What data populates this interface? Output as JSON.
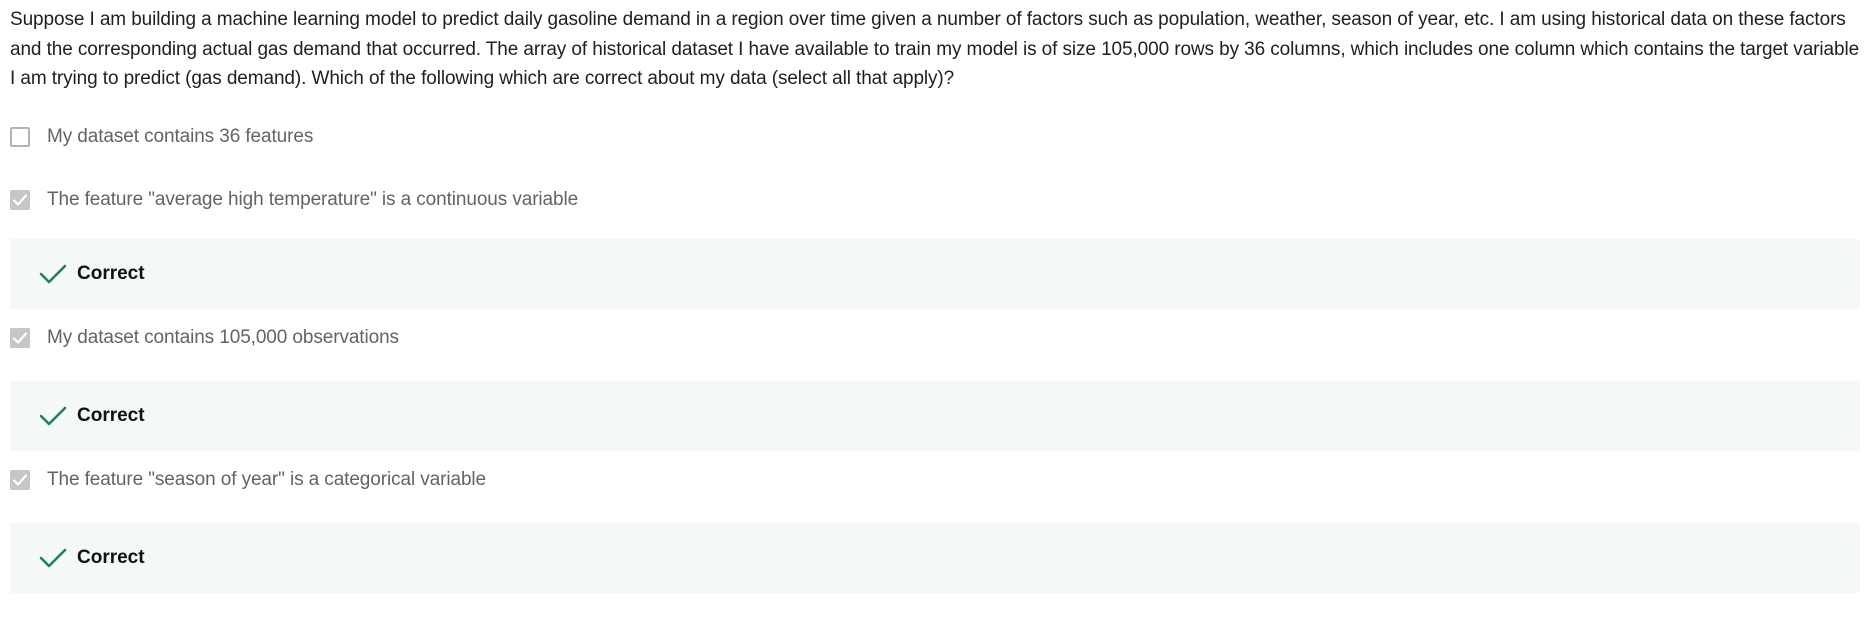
{
  "question": {
    "text": "Suppose I am building a machine learning model to predict daily gasoline demand in a region over time given a number of factors such as population, weather, season of year, etc.  I am using historical data on these factors and the corresponding actual gas demand that occurred.  The array of historical dataset I have available to train my model is of size 105,000 rows by 36 columns, which includes one column which contains the target variable I am trying to predict (gas demand). Which of the following which are correct about my data (select all that apply)?"
  },
  "options": [
    {
      "label": "My dataset contains 36 features",
      "checked": false
    },
    {
      "label": "The feature \"average high temperature\" is a continuous variable",
      "checked": true,
      "feedback": "Correct"
    },
    {
      "label": "My dataset contains 105,000 observations",
      "checked": true,
      "feedback": "Correct"
    },
    {
      "label": "The feature \"season of year\" is a categorical variable",
      "checked": true,
      "feedback": "Correct"
    }
  ],
  "colors": {
    "correct_check": "#1f8354",
    "checkbox_checked_bg": "#c6c6c6",
    "feedback_bg": "#f4f8f7"
  }
}
